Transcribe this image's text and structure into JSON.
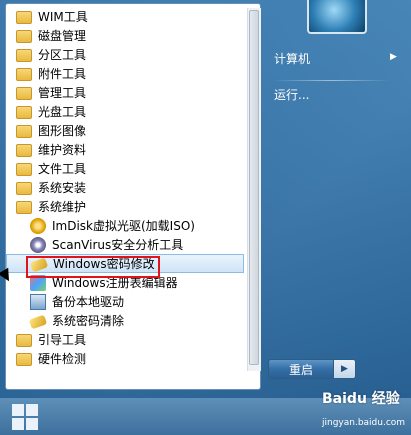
{
  "menu": {
    "items": [
      {
        "label": "WIM工具",
        "icon": "folder-icon",
        "level": 0
      },
      {
        "label": "磁盘管理",
        "icon": "folder-icon",
        "level": 0
      },
      {
        "label": "分区工具",
        "icon": "folder-icon",
        "level": 0
      },
      {
        "label": "附件工具",
        "icon": "folder-icon",
        "level": 0
      },
      {
        "label": "管理工具",
        "icon": "folder-icon",
        "level": 0
      },
      {
        "label": "光盘工具",
        "icon": "folder-icon",
        "level": 0
      },
      {
        "label": "图形图像",
        "icon": "folder-icon",
        "level": 0
      },
      {
        "label": "维护资料",
        "icon": "folder-icon",
        "level": 0
      },
      {
        "label": "文件工具",
        "icon": "folder-icon",
        "level": 0
      },
      {
        "label": "系统安装",
        "icon": "folder-icon",
        "level": 0
      },
      {
        "label": "系统维护",
        "icon": "folder-icon",
        "level": 0
      },
      {
        "label": "ImDisk虚拟光驱(加载ISO)",
        "icon": "disk-icon",
        "level": 1
      },
      {
        "label": "ScanVirus安全分析工具",
        "icon": "scan-icon",
        "level": 1
      },
      {
        "label": "Windows密码修改",
        "icon": "key-icon",
        "level": 1,
        "selected": true
      },
      {
        "label": "Windows注册表编辑器",
        "icon": "registry-icon",
        "level": 1
      },
      {
        "label": "备份本地驱动",
        "icon": "backup-icon",
        "level": 1
      },
      {
        "label": "系统密码清除",
        "icon": "key-icon",
        "level": 1
      },
      {
        "label": "引导工具",
        "icon": "folder-icon",
        "level": 0
      },
      {
        "label": "硬件检测",
        "icon": "folder-icon",
        "level": 0
      }
    ]
  },
  "right_panel": {
    "computer_label": "计算机",
    "run_label": "运行..."
  },
  "shutdown": {
    "label": "重启",
    "arrow": "▶"
  },
  "watermark": {
    "text": "Baidu 经验",
    "url": "jingyan.baidu.com"
  },
  "colors": {
    "highlight_border": "#e0151b",
    "selection_bg": "#cfe4f7"
  }
}
